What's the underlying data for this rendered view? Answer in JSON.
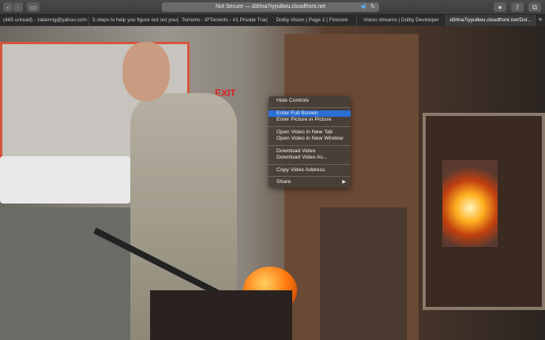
{
  "titlebar": {
    "address": "Not Secure — d3rlna7iyyu8wu.cloudfront.net"
  },
  "tabs": [
    "(465 unread) - zalamng@yahoo.com -...",
    "5 steps to help you figure out out your...",
    "Torrents - IPTorrents - #1 Private Trac...",
    "Dolby Vision | Page 2 | Firecore",
    "Vision streams | Dolby Developer",
    "d3rlna7iyyu8wu.cloudfront.net/Dol..."
  ],
  "video": {
    "exit_sign": "EXIT"
  },
  "context_menu": {
    "items": [
      "Hide Controls",
      "Enter Full Screen",
      "Enter Picture in Picture",
      "Open Video in New Tab",
      "Open Video in New Window",
      "Download Video",
      "Download Video As...",
      "Copy Video Address",
      "Share"
    ],
    "highlighted": "Enter Full Screen"
  }
}
